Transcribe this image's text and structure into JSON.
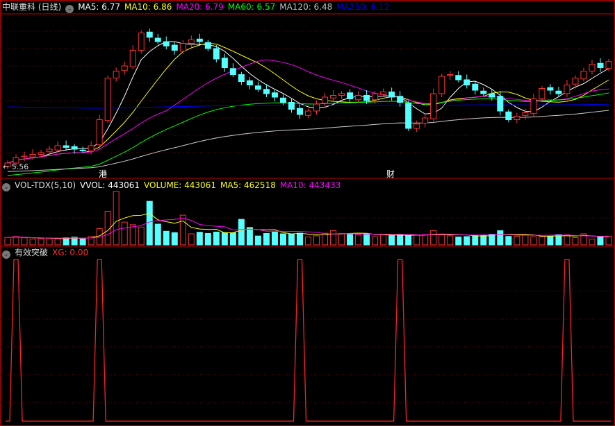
{
  "title": "中联重科 (日线)",
  "price_header": [
    {
      "label": "MA5: 6.77",
      "color": "#ffffff"
    },
    {
      "label": "MA10: 6.86",
      "color": "#ffff00"
    },
    {
      "label": "MA20: 6.79",
      "color": "#ff00ff"
    },
    {
      "label": "MA60: 6.57",
      "color": "#00ff00"
    },
    {
      "label": "MA120: 6.48",
      "color": "#c0c0c0"
    },
    {
      "label": "MA250: 6.12",
      "color": "#0000ff"
    }
  ],
  "low_label": "← 5.56",
  "markers": [
    {
      "text": "港",
      "index": 11
    },
    {
      "text": "财",
      "index": 46
    }
  ],
  "vol_header": {
    "name": "VOL-TDX(5,10)",
    "vvol": "VVOL: 443061",
    "volume": "VOLUME: 443061",
    "ma5": "MA5: 462518",
    "ma10": "MA10: 443433"
  },
  "xg_header": {
    "name": "有效突破",
    "xg": "XG: 0.00"
  },
  "colors": {
    "up": "#ff3232",
    "down": "#54ffff",
    "frame": "#c00000"
  },
  "chart_data": {
    "type": "candlestick",
    "price_range": [
      5.56,
      7.2
    ],
    "close": [
      5.6,
      5.66,
      5.68,
      5.7,
      5.72,
      5.76,
      5.8,
      5.78,
      5.76,
      5.74,
      5.8,
      6.1,
      6.58,
      6.66,
      6.72,
      6.9,
      7.1,
      7.05,
      7.0,
      6.95,
      6.9,
      6.98,
      7.02,
      7.0,
      6.92,
      6.8,
      6.7,
      6.62,
      6.54,
      6.5,
      6.45,
      6.4,
      6.36,
      6.3,
      6.22,
      6.16,
      6.2,
      6.28,
      6.36,
      6.38,
      6.4,
      6.34,
      6.38,
      6.32,
      6.4,
      6.42,
      6.36,
      6.3,
      6.0,
      6.05,
      6.12,
      6.4,
      6.6,
      6.62,
      6.56,
      6.5,
      6.44,
      6.4,
      6.36,
      6.2,
      6.1,
      6.14,
      6.18,
      6.34,
      6.46,
      6.44,
      6.4,
      6.5,
      6.58,
      6.66,
      6.74,
      6.7,
      6.77
    ],
    "volume": [
      380000,
      420000,
      360000,
      300000,
      320000,
      330000,
      310000,
      360000,
      390000,
      300000,
      420000,
      820000,
      1700000,
      2700000,
      1150000,
      1020000,
      900000,
      2200000,
      1050000,
      690000,
      620000,
      1500000,
      560000,
      640000,
      580000,
      650000,
      620000,
      610000,
      1290000,
      880000,
      450000,
      580000,
      650000,
      560000,
      540000,
      590000,
      400000,
      460000,
      590000,
      720000,
      580000,
      560000,
      520000,
      560000,
      410000,
      540000,
      470000,
      500000,
      480000,
      500000,
      520000,
      720000,
      510000,
      460000,
      400000,
      420000,
      480000,
      500000,
      540000,
      720000,
      430000,
      440000,
      510000,
      410000,
      420000,
      440000,
      520000,
      510000,
      370000,
      560000,
      290000,
      410000,
      443061
    ],
    "xg": [
      0,
      1,
      0,
      0,
      0,
      0,
      0,
      0,
      0,
      0,
      0,
      1,
      0,
      0,
      0,
      0,
      0,
      0,
      0,
      0,
      0,
      0,
      0,
      0,
      0,
      0,
      0,
      0,
      0,
      0,
      0,
      0,
      0,
      0,
      0,
      1,
      0,
      0,
      0,
      0,
      0,
      0,
      0,
      0,
      0,
      0,
      0,
      1,
      0,
      0,
      0,
      0,
      0,
      0,
      0,
      0,
      0,
      0,
      0,
      0,
      0,
      0,
      0,
      0,
      0,
      0,
      0,
      1,
      0,
      0,
      0,
      0,
      0
    ],
    "ma_periods": [
      5,
      10,
      20,
      60,
      120,
      250
    ]
  }
}
